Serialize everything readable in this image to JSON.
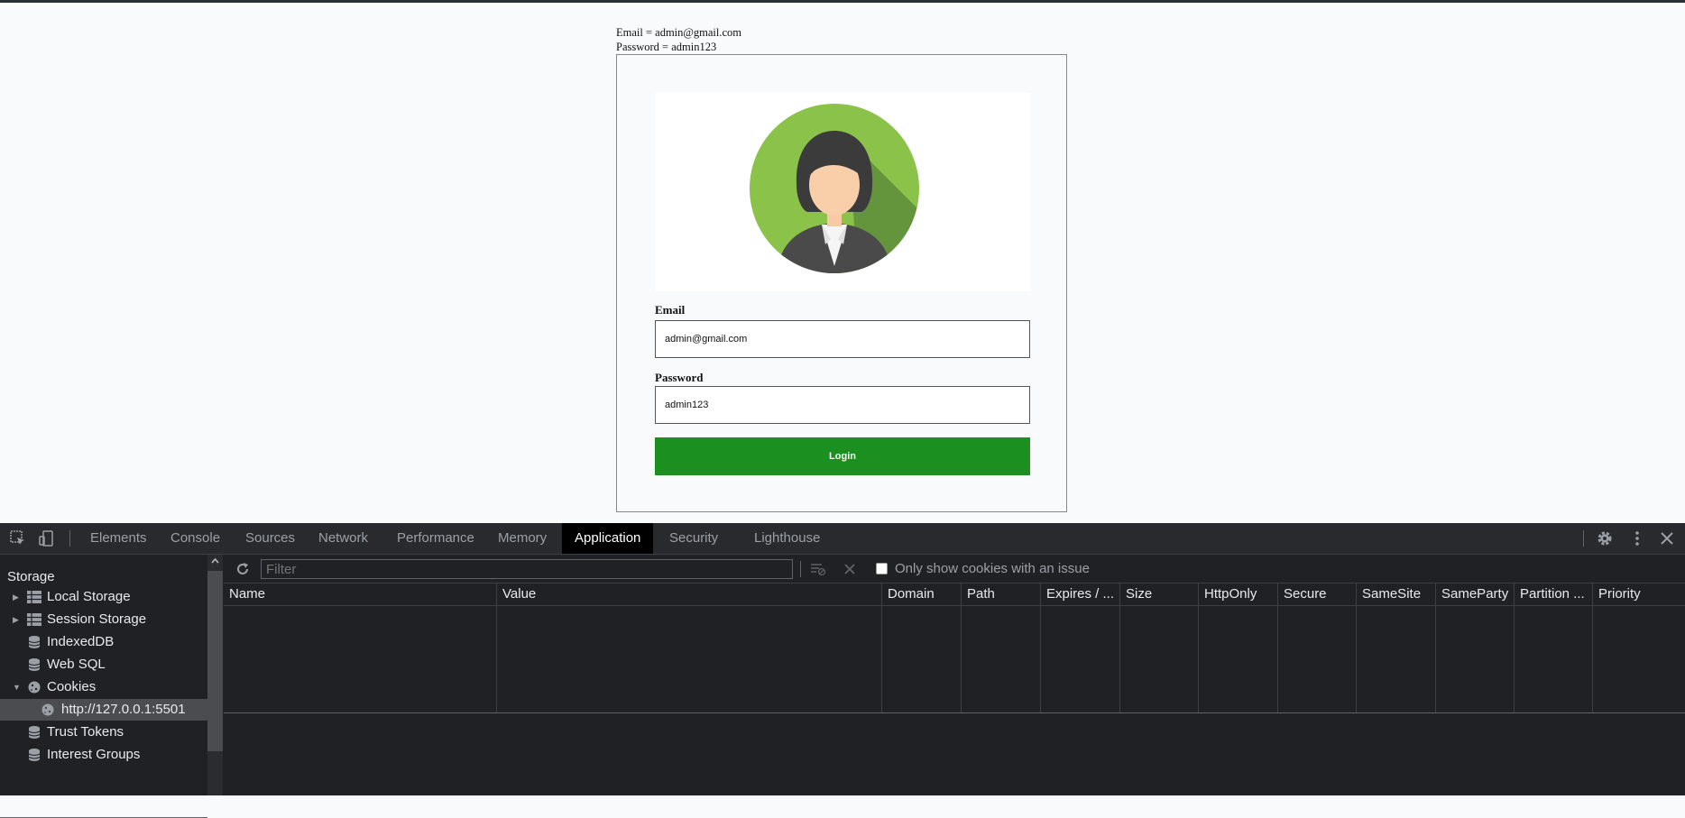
{
  "page": {
    "hint_email": "Email = admin@gmail.com",
    "hint_password": "Password = admin123",
    "email_label": "Email",
    "email_value": "admin@gmail.com",
    "password_label": "Password",
    "password_value": "admin123",
    "login_label": "Login",
    "colors": {
      "button": "#1b8f1f",
      "avatar_bg": "#8bc34a"
    }
  },
  "devtools": {
    "tabs": [
      {
        "label": "Elements"
      },
      {
        "label": "Console"
      },
      {
        "label": "Sources"
      },
      {
        "label": "Network"
      },
      {
        "label": "Performance"
      },
      {
        "label": "Memory"
      },
      {
        "label": "Application",
        "active": true
      },
      {
        "label": "Security"
      },
      {
        "label": "Lighthouse"
      }
    ],
    "icons": [
      "inspect-icon",
      "device-toolbar-icon",
      "settings-icon",
      "more-icon",
      "close-icon"
    ],
    "sidebar": {
      "heading": "Storage",
      "items": [
        {
          "label": "Local Storage",
          "icon": "grid-icon",
          "expand": "collapsed"
        },
        {
          "label": "Session Storage",
          "icon": "grid-icon",
          "expand": "collapsed"
        },
        {
          "label": "IndexedDB",
          "icon": "database-icon"
        },
        {
          "label": "Web SQL",
          "icon": "database-icon"
        },
        {
          "label": "Cookies",
          "icon": "cookie-icon",
          "expand": "expanded"
        },
        {
          "label": "http://127.0.0.1:5501",
          "icon": "cookie-icon",
          "selected": true
        },
        {
          "label": "Trust Tokens",
          "icon": "database-icon"
        },
        {
          "label": "Interest Groups",
          "icon": "database-icon"
        }
      ]
    },
    "cookies": {
      "filter_placeholder": "Filter",
      "issue_checkbox_label": "Only show cookies with an issue",
      "issue_checkbox_checked": false,
      "columns": [
        "Name",
        "Value",
        "Domain",
        "Path",
        "Expires / ...",
        "Size",
        "HttpOnly",
        "Secure",
        "SameSite",
        "SameParty",
        "Partition ...",
        "Priority"
      ]
    }
  }
}
